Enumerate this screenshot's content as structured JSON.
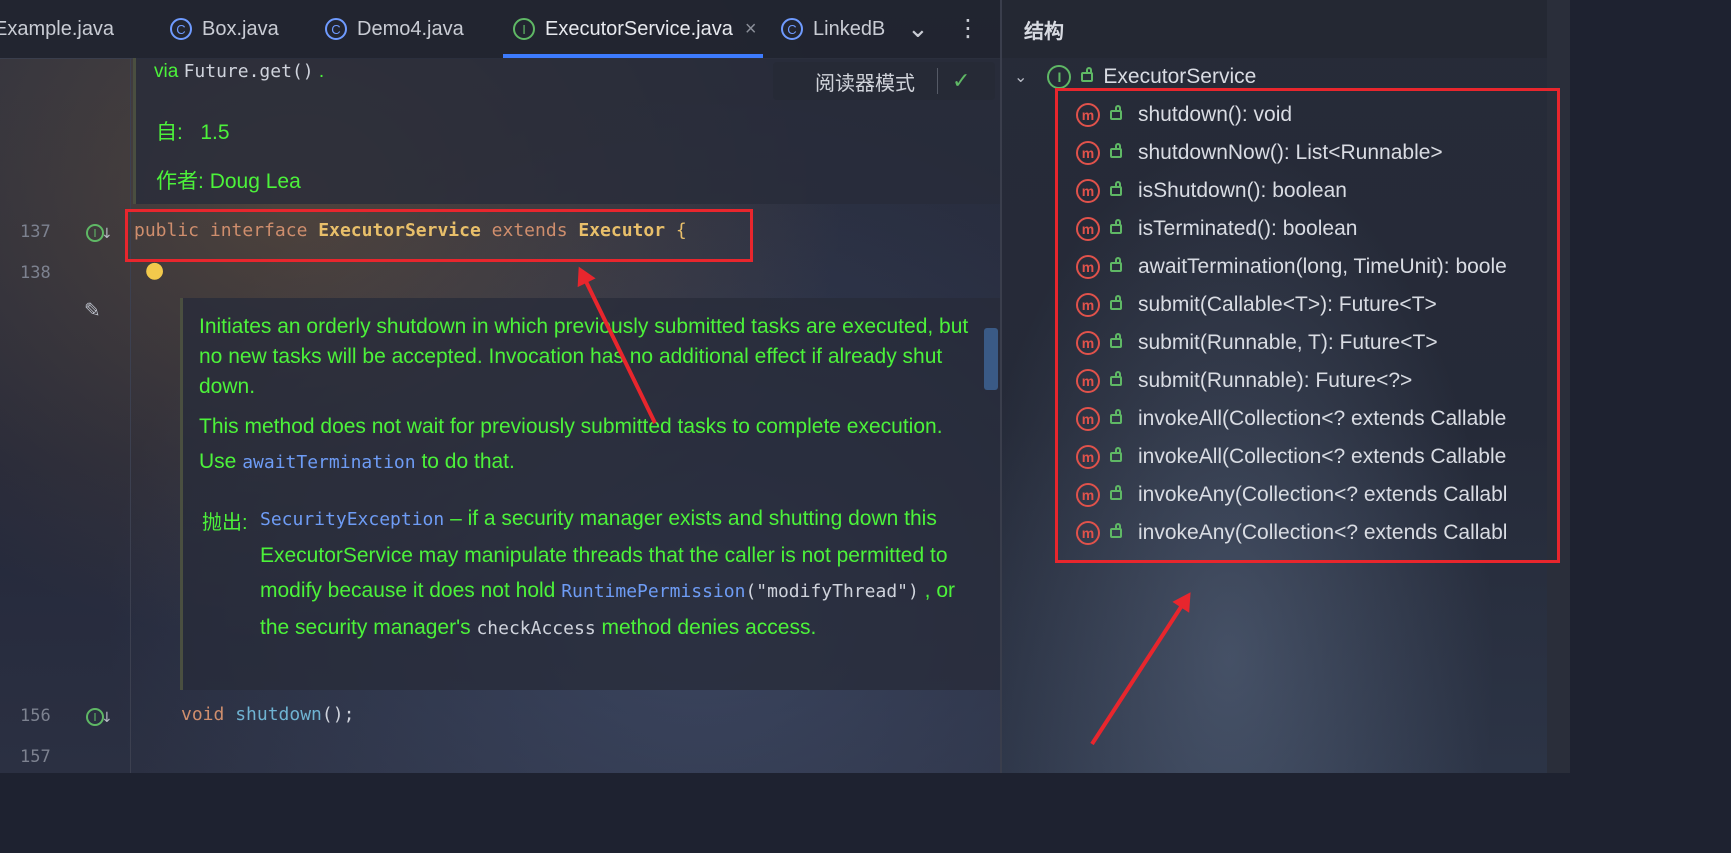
{
  "tabs": [
    {
      "label": "Example.java",
      "icon": "class-icon"
    },
    {
      "label": "Box.java",
      "icon": "class-icon"
    },
    {
      "label": "Demo4.java",
      "icon": "runnable-class-icon"
    },
    {
      "label": "ExecutorService.java",
      "icon": "interface-icon"
    },
    {
      "label": "LinkedB",
      "icon": "class-icon"
    }
  ],
  "tab_close_glyph": "×",
  "tab_more_glyph": "⋮",
  "tab_overflow_glyph": "⌄",
  "reader_mode": {
    "label": "阅读器模式",
    "check": "✓"
  },
  "doc_top": {
    "via_text": "via ",
    "via_code": "Future.get()",
    "via_end": " .",
    "since_label": "自:",
    "since_value": "1.5",
    "author_label": "作者:",
    "author_value": "Doug Lea"
  },
  "line_numbers": {
    "l137": "137",
    "l138": "138",
    "l156": "156",
    "l157": "157"
  },
  "code_137": {
    "kw1": "public",
    "kw2": "interface",
    "name": "ExecutorService",
    "kw3": "extends",
    "parent": "Executor",
    "brace": "{"
  },
  "code_156": {
    "kw": "void",
    "name": "shutdown",
    "tail": "();"
  },
  "doc_main": {
    "p1": "Initiates an orderly shutdown in which previously submitted tasks are executed, but no new tasks will be accepted. Invocation has no additional effect if already shut down.",
    "p2_a": "This method does not wait for previously submitted tasks to complete execution. Use",
    "p2_code": "awaitTermination",
    "p2_b": "to do that.",
    "throws_label": "抛出:",
    "throws_code": "SecurityException",
    "throws_text": " – if a security manager exists and shutting down this ExecutorService may manipulate threads that the caller is not permitted to modify because it does not hold",
    "perm_code": "RuntimePermission",
    "perm_arg": "(\"modifyThread\")",
    "perm_text": " , or the security manager's",
    "check_code": "checkAccess",
    "check_text": " method denies access."
  },
  "structure_panel": {
    "title": "结构",
    "root": "ExecutorService",
    "methods": [
      "shutdown(): void",
      "shutdownNow(): List<Runnable>",
      "isShutdown(): boolean",
      "isTerminated(): boolean",
      "awaitTermination(long, TimeUnit): boole",
      "submit(Callable<T>): Future<T>",
      "submit(Runnable, T): Future<T>",
      "submit(Runnable): Future<?>",
      "invokeAll(Collection<? extends Callable",
      "invokeAll(Collection<? extends Callable",
      "invokeAny(Collection<? extends Callabl",
      "invokeAny(Collection<? extends Callabl"
    ]
  },
  "colors": {
    "annotation_red": "#e8262d",
    "doc_green": "#4cf23a",
    "keyword_orange": "#cf8e6d",
    "type_yellow": "#e8bf6a",
    "accent_blue": "#3d7bfd"
  }
}
